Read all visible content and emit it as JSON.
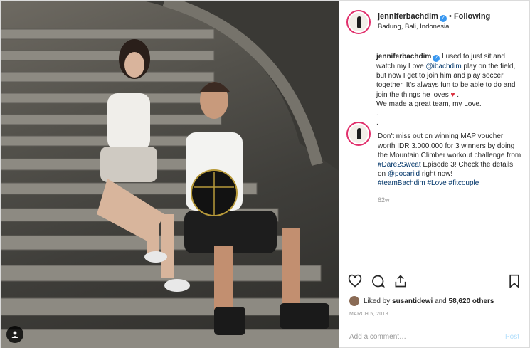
{
  "header": {
    "username": "jenniferbachdim",
    "separator": "•",
    "follow_label": "Following",
    "location": "Badung, Bali, Indonesia"
  },
  "caption": {
    "username": "jenniferbachdim",
    "text_1": " I used to just sit and watch my Love ",
    "mention_1": "@ibachdim",
    "text_2": " play on the field, but now I get to join him and play soccer together. It's always fun to be able to do and join the things he loves ",
    "heart": "♥",
    "text_3": " .",
    "line_2": "We made a great team, my Love.",
    "dot_1": ".",
    "dot_2": "."
  },
  "sponsored": {
    "text_1": "Don't miss out on winning MAP voucher worth IDR 3.000.000 for 3 winners by doing the Mountain Climber workout challenge from ",
    "hashtag_1": "#Dare2Sweat",
    "text_2": " Episode 3! Check the details on ",
    "mention_2": "@pocariid",
    "text_3": " right now!",
    "hashtag_2": "#teamBachdim",
    "hashtag_3": "#Love",
    "hashtag_4": "#fitcouple",
    "time": "62w"
  },
  "likes": {
    "prefix": "Liked by ",
    "user": "susantidewi",
    "middle": " and ",
    "count": "58,620 others"
  },
  "date": "MARCH 5, 2018",
  "comment_box": {
    "placeholder": "Add a comment…",
    "post_label": "Post"
  },
  "icons": [
    "heart-icon",
    "comment-icon",
    "share-icon",
    "bookmark-icon",
    "user-tag-icon",
    "verified-icon"
  ],
  "colors": {
    "link": "#003569",
    "verified": "#3897f0",
    "heart": "#d92b3a",
    "post_disabled": "#b2dffc"
  }
}
